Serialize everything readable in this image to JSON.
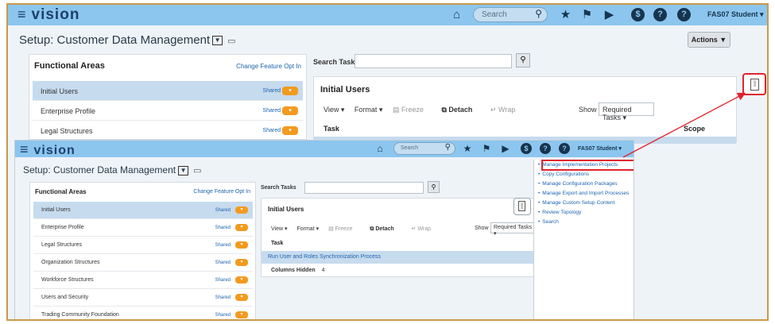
{
  "main": {
    "topbar": {
      "logo": "vision",
      "search_placeholder": "Search",
      "user": "FAS07 Student ▾",
      "icons": [
        "home-icon",
        "search-icon",
        "star-icon",
        "flag-icon",
        "play-icon",
        "dollar-icon",
        "help-icon",
        "notifications-icon"
      ]
    },
    "page_title": "Setup: Customer Data Management",
    "actions_label": "Actions ▼",
    "functional_areas": {
      "heading": "Functional Areas",
      "link": "Change Feature Opt In",
      "rows": [
        {
          "label": "Initial Users",
          "shared": "Shared"
        },
        {
          "label": "Enterprise Profile",
          "shared": "Shared"
        },
        {
          "label": "Legal Structures",
          "shared": "Shared"
        }
      ]
    },
    "search_tasks_label": "Search Tasks",
    "task_panel": {
      "heading": "Initial Users",
      "view": "View ▾",
      "format": "Format ▾",
      "freeze": "Freeze",
      "detach": "Detach",
      "wrap": "Wrap",
      "show": "Show",
      "show_value": "Required Tasks ▾",
      "col_task": "Task",
      "col_scope": "Scope"
    }
  },
  "sub": {
    "topbar": {
      "logo": "vision",
      "search_placeholder": "Search",
      "user": "FAS07 Student ▾"
    },
    "page_title": "Setup: Customer Data Management",
    "functional_areas": {
      "heading": "Functional Areas",
      "link": "Change Feature Opt In",
      "rows": [
        {
          "label": "Initial Users",
          "shared": "Shared"
        },
        {
          "label": "Enterprise Profile",
          "shared": "Shared"
        },
        {
          "label": "Legal Structures",
          "shared": "Shared"
        },
        {
          "label": "Organization Structures",
          "shared": "Shared"
        },
        {
          "label": "Workforce Structures",
          "shared": "Shared"
        },
        {
          "label": "Users and Security",
          "shared": "Shared"
        },
        {
          "label": "Trading Community Foundation",
          "shared": "Shared"
        }
      ]
    },
    "search_tasks_label": "Search Tasks",
    "task_panel": {
      "heading": "Initial Users",
      "view": "View ▾",
      "format": "Format ▾",
      "freeze": "Freeze",
      "detach": "Detach",
      "wrap": "Wrap",
      "show": "Show",
      "show_value": "Required Tasks ▾",
      "col_task": "Task",
      "row_task": "Run User and Roles Synchronization Process",
      "columns_hidden_label": "Columns Hidden",
      "columns_hidden_value": "4"
    },
    "tasks_menu": [
      "Manage Implementation Projects",
      "Copy Configurations",
      "Manage Configuration Packages",
      "Manage Export and Import Processes",
      "Manage Custom Setup Content",
      "Review Topology",
      "Search"
    ]
  }
}
